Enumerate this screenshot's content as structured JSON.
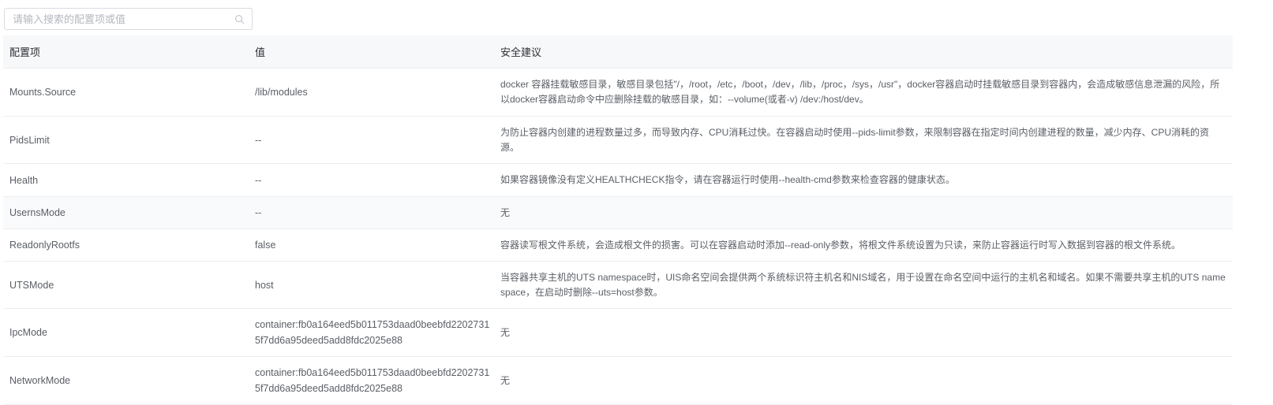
{
  "search": {
    "placeholder": "请输入搜索的配置项或值"
  },
  "table": {
    "headers": [
      "配置项",
      "值",
      "安全建议"
    ],
    "rows": [
      {
        "item": "Mounts.Source",
        "value": "/lib/modules",
        "advice": "docker 容器挂载敏感目录，敏感目录包括\"/，/root，/etc，/boot，/dev，/lib，/proc，/sys，/usr\"，docker容器启动时挂载敏感目录到容器内，会造成敏感信息泄漏的风险，所以docker容器启动命令中应删除挂载的敏感目录，如：--volume(或者-v) /dev:/host/dev。"
      },
      {
        "item": "PidsLimit",
        "value": "--",
        "advice": "为防止容器内创建的进程数量过多，而导致内存、CPU消耗过快。在容器启动时使用--pids-limit参数，来限制容器在指定时间内创建进程的数量，减少内存、CPU消耗的资源。"
      },
      {
        "item": "Health",
        "value": "--",
        "advice": "如果容器镜像没有定义HEALTHCHECK指令，请在容器运行时使用--health-cmd参数来检查容器的健康状态。"
      },
      {
        "item": "UsernsMode",
        "value": "--",
        "advice": "无"
      },
      {
        "item": "ReadonlyRootfs",
        "value": "false",
        "advice": "容器读写根文件系统，会造成根文件的损害。可以在容器启动时添加--read-only参数，将根文件系统设置为只读，来防止容器运行时写入数据到容器的根文件系统。"
      },
      {
        "item": "UTSMode",
        "value": "host",
        "advice": "当容器共享主机的UTS namespace时，UIS命名空间会提供两个系统标识符主机名和NIS域名，用于设置在命名空间中运行的主机名和域名。如果不需要共享主机的UTS namespace，在启动时删除--uts=host参数。"
      },
      {
        "item": "IpcMode",
        "value": "container:fb0a164eed5b011753daad0beebfd22027315f7dd6a95deed5add8fdc2025e88",
        "advice": "无"
      },
      {
        "item": "NetworkMode",
        "value": "container:fb0a164eed5b011753daad0beebfd22027315f7dd6a95deed5add8fdc2025e88",
        "advice": "无"
      }
    ]
  }
}
